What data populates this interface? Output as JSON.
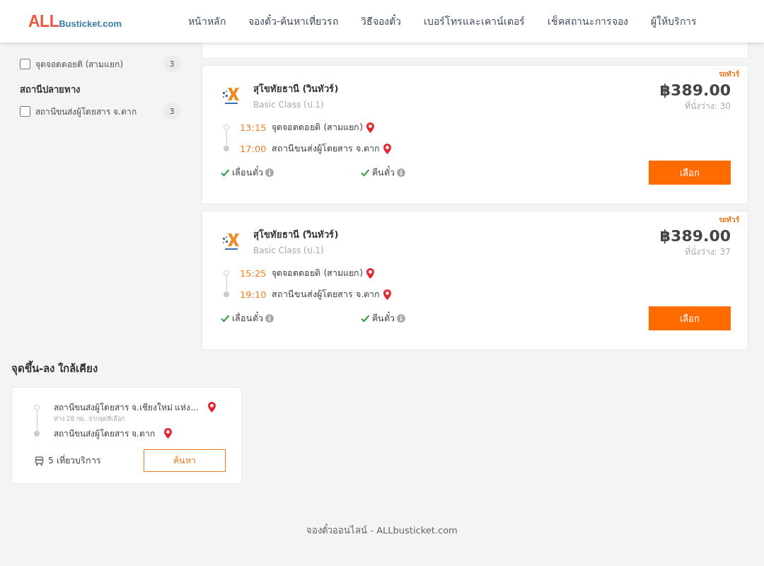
{
  "header": {
    "logo": {
      "mark": "ALL",
      "name": "Busticket.com"
    },
    "nav": [
      {
        "label": "หน้าหลัก"
      },
      {
        "label": "จองตั๋ว-ค้นหาเที่ยวรถ"
      },
      {
        "label": "วิธีจองตั๋ว"
      },
      {
        "label": "เบอร์โทรและเคาน์เตอร์"
      },
      {
        "label": "เช็คสถานะการจอง"
      },
      {
        "label": "ผู้ให้บริการ"
      }
    ]
  },
  "filter_groups": [
    {
      "options": [
        {
          "label": "จุดจอดดอยติ (สามแยก)",
          "count": "3",
          "checked": false
        }
      ]
    },
    {
      "title": "สถานีปลายทาง",
      "options": [
        {
          "label": "สถานีขนส่งผู้โดยสาร จ.ตาก",
          "count": "3",
          "checked": false
        }
      ]
    }
  ],
  "trips": [
    {
      "tag": "รถทัวร์",
      "operator": "สุโขทัยธานี (วินทัวร์)",
      "bus_class": "Basic Class (ป.1)",
      "price": "฿389.00",
      "seats": "ที่นั่งว่าง: 30",
      "stops": [
        {
          "kind": "departure",
          "time": "13:15",
          "place": "จุดจอดดอยติ (สามแยก)"
        },
        {
          "kind": "arrival",
          "time": "17:00",
          "place": "สถานีขนส่งผู้โดยสาร จ.ตาก"
        }
      ],
      "features": [
        {
          "label": "เลื่อนตั๋ว",
          "available": true
        },
        {
          "label": "คืนตั๋ว",
          "available": true
        }
      ],
      "button": "เลือก"
    },
    {
      "tag": "รถทัวร์",
      "operator": "สุโขทัยธานี (วินทัวร์)",
      "bus_class": "Basic Class (ป.1)",
      "price": "฿389.00",
      "seats": "ที่นั่งว่าง: 37",
      "stops": [
        {
          "kind": "departure",
          "time": "15:25",
          "place": "จุดจอดดอยติ (สามแยก)"
        },
        {
          "kind": "arrival",
          "time": "19:10",
          "place": "สถานีขนส่งผู้โดยสาร จ.ตาก"
        }
      ],
      "features": [
        {
          "label": "เลื่อนตั๋ว",
          "available": true
        },
        {
          "label": "คืนตั๋ว",
          "available": true
        }
      ],
      "button": "เลือก"
    }
  ],
  "nearby": {
    "title": "จุดขึ้น-ลง ใกล้เคียง",
    "stops": [
      {
        "kind": "departure",
        "place": "สถานีขนส่งผู้โดยสาร จ.เชียงใหม่ แห่ง...",
        "note": "ห่าง 28 กม. จากจุดที่เลือก"
      },
      {
        "kind": "arrival",
        "place": "สถานีขนส่งผู้โดยสาร จ.ตาก"
      }
    ],
    "trip_count": "5 เที่ยวบริการ",
    "button": "ค้นหา"
  },
  "footer": "จองตั๋วออนไลน์ - ALLbusticket.com"
}
